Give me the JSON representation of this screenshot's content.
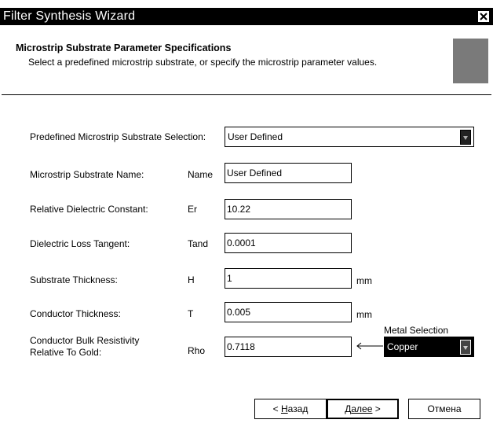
{
  "window": {
    "title": "Filter Synthesis Wizard"
  },
  "header": {
    "title": "Microstrip Substrate Parameter Specifications",
    "subtitle": "Select a predefined microstrip substrate, or specify the microstrip parameter values."
  },
  "form": {
    "predefined": {
      "label": "Predefined Microstrip Substrate Selection:",
      "value": "User Defined"
    },
    "name": {
      "label": "Microstrip Substrate Name:",
      "symbol": "Name",
      "value": "User Defined"
    },
    "er": {
      "label": "Relative Dielectric Constant:",
      "symbol": "Er",
      "value": "10.22"
    },
    "tand": {
      "label": "Dielectric Loss Tangent:",
      "symbol": "Tand",
      "value": "0.0001"
    },
    "h": {
      "label": "Substrate Thickness:",
      "symbol": "H",
      "value": "1",
      "unit": "mm"
    },
    "t": {
      "label": "Conductor Thickness:",
      "symbol": "T",
      "value": "0.005",
      "unit": "mm"
    },
    "rho": {
      "label_line1": "Conductor Bulk Resistivity",
      "label_line2": "Relative To Gold:",
      "symbol": "Rho",
      "value": "0.7118"
    },
    "metal": {
      "label": "Metal Selection",
      "value": "Copper"
    }
  },
  "footer": {
    "back_prefix": "< ",
    "back_accel": "Н",
    "back_rest": "азад",
    "next_accel": "Д",
    "next_rest": "алее",
    "next_suffix": " >",
    "cancel_label": "Отмена"
  }
}
